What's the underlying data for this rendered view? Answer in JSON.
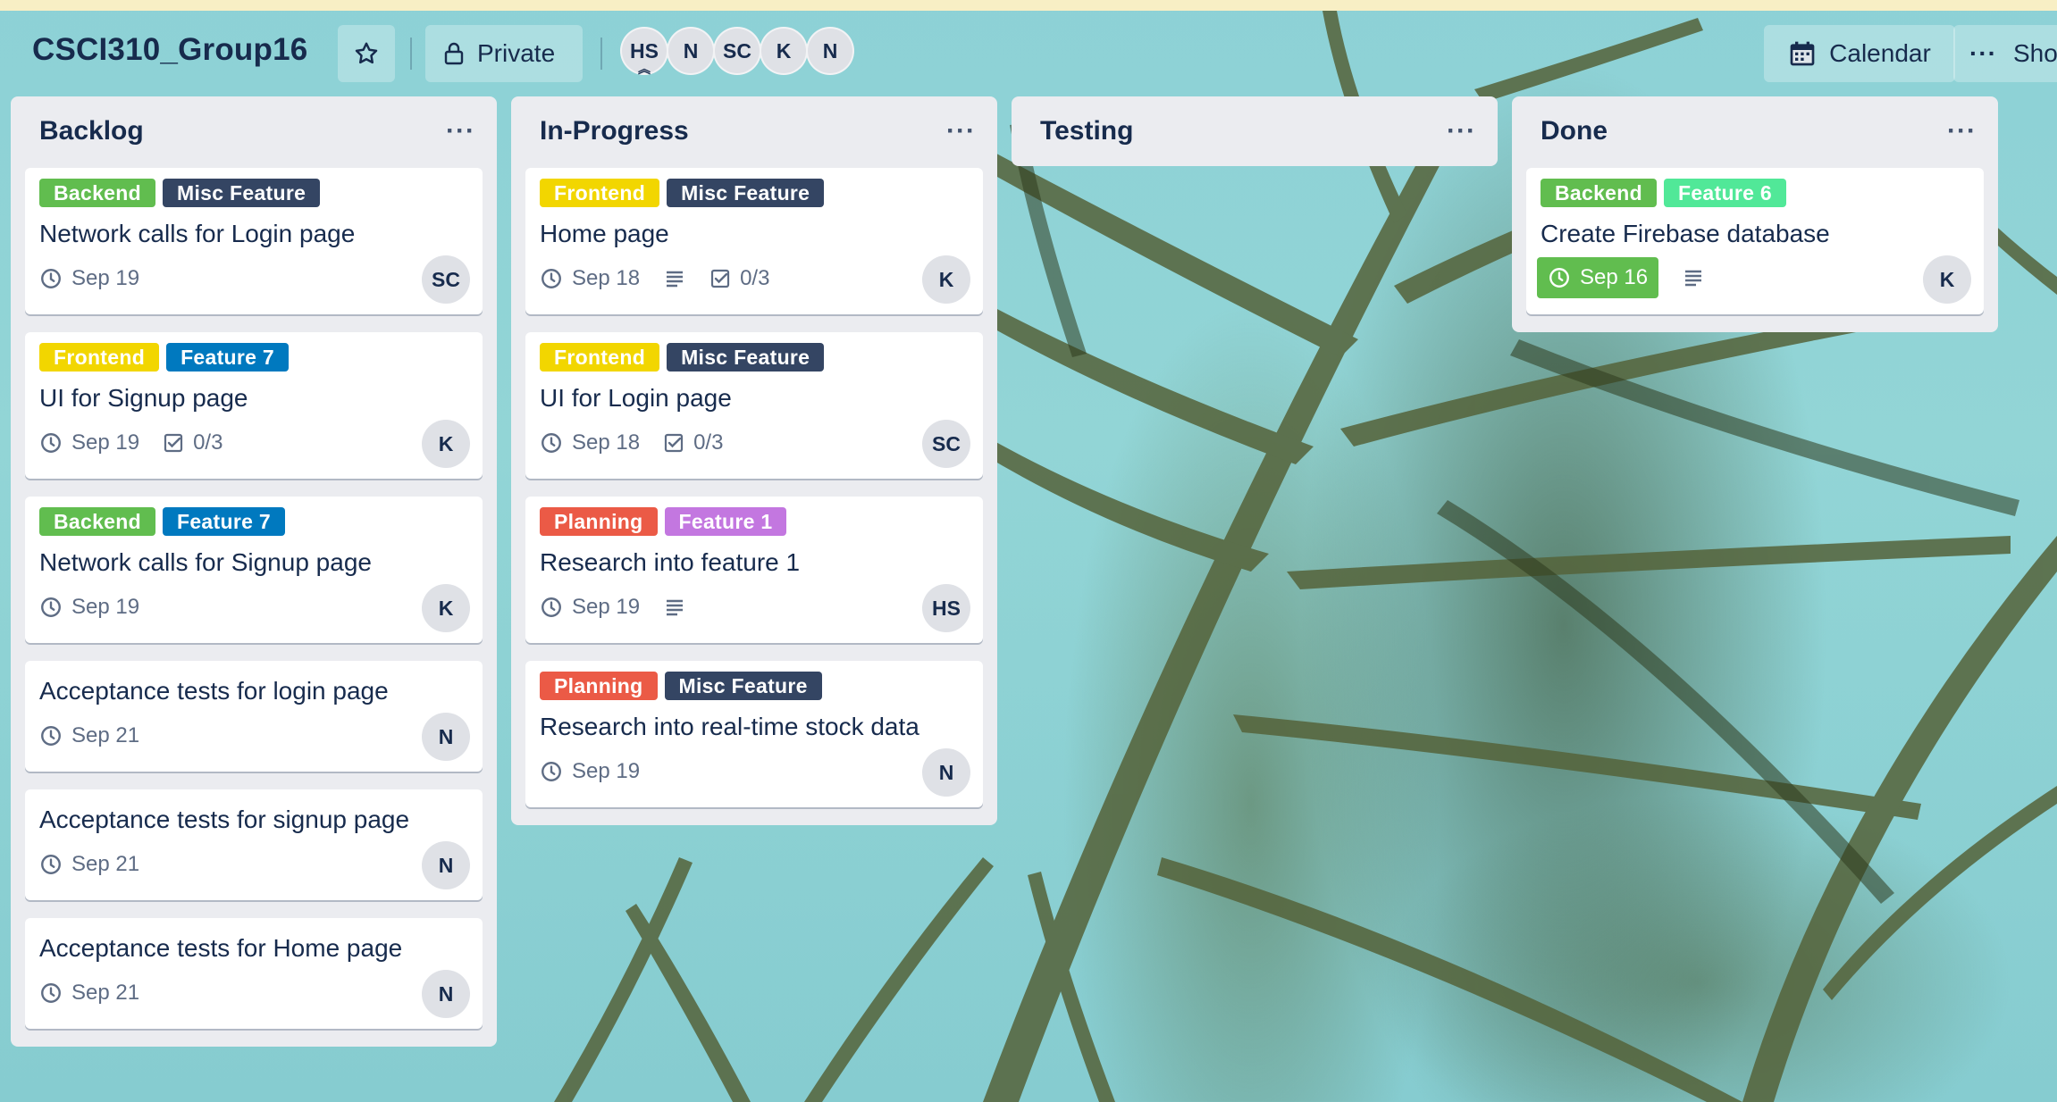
{
  "board": {
    "title": "CSCI310_Group16",
    "visibility": "Private",
    "members": [
      "HS",
      "N",
      "SC",
      "K",
      "N"
    ],
    "calendar_label": "Calendar",
    "show_menu_label": "Sho"
  },
  "colors": {
    "green": "#61bd4f",
    "navy": "#344563",
    "yellow": "#f2d600",
    "blue": "#0079bf",
    "orange": "#eb5a46",
    "purple": "#c377e0",
    "lime": "#51e898"
  },
  "lists": [
    {
      "title": "Backlog",
      "cards": [
        {
          "labels": [
            "Backend",
            "Misc Feature"
          ],
          "title": "Network calls for Login page",
          "due": "Sep 19",
          "member": "SC"
        },
        {
          "labels": [
            "Frontend",
            "Feature 7"
          ],
          "title": "UI for Signup page",
          "due": "Sep 19",
          "checklist": "0/3",
          "member": "K"
        },
        {
          "labels": [
            "Backend",
            "Feature 7"
          ],
          "title": "Network calls for Signup page",
          "due": "Sep 19",
          "member": "K"
        },
        {
          "title": "Acceptance tests for login page",
          "due": "Sep 21",
          "member": "N"
        },
        {
          "title": "Acceptance tests for signup page",
          "due": "Sep 21",
          "member": "N"
        },
        {
          "title": "Acceptance tests for Home page",
          "due": "Sep 21",
          "member": "N"
        }
      ]
    },
    {
      "title": "In-Progress",
      "cards": [
        {
          "labels": [
            "Frontend",
            "Misc Feature"
          ],
          "title": "Home page",
          "due": "Sep 18",
          "checklist": "0/3",
          "member": "K"
        },
        {
          "labels": [
            "Frontend",
            "Misc Feature"
          ],
          "title": "UI for Login page",
          "due": "Sep 18",
          "checklist": "0/3",
          "member": "SC"
        },
        {
          "labels": [
            "Planning",
            "Feature 1"
          ],
          "title": "Research into feature 1",
          "due": "Sep 19",
          "member": "HS"
        },
        {
          "labels": [
            "Planning",
            "Misc Feature"
          ],
          "title": "Research into real-time stock data",
          "due": "Sep 19",
          "member": "N"
        }
      ]
    },
    {
      "title": "Testing",
      "cards": []
    },
    {
      "title": "Done",
      "cards": [
        {
          "labels": [
            "Backend",
            "Feature 6"
          ],
          "title": "Create Firebase database",
          "due": "Sep 16",
          "member": "K"
        }
      ]
    }
  ]
}
